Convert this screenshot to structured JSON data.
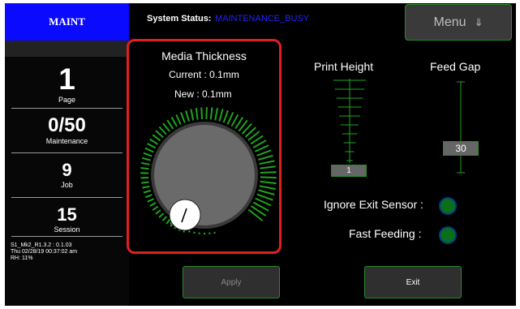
{
  "header": {
    "badge": "MAINT",
    "status_label": "System Status:",
    "status_value": "MAINTENANCE_BUSY",
    "menu_label": "Menu",
    "menu_arrow": "⇓"
  },
  "sidebar": {
    "stats": [
      {
        "value": "1",
        "label": "Page"
      },
      {
        "value": "0/50",
        "label": "Maintenance"
      },
      {
        "value": "9",
        "label": "Job"
      },
      {
        "value": "15",
        "label": "Session"
      }
    ],
    "info": {
      "version": "S1_Mk2_R1.3.2 : 0.1.03",
      "datetime": "Thu 02/28/19 00:37:02 am",
      "humidity": "RH: 11%"
    }
  },
  "media_thickness": {
    "title": "Media Thickness",
    "current": "Current : 0.1mm",
    "new": "New : 0.1mm"
  },
  "print_height": {
    "label": "Print Height",
    "value": "1"
  },
  "feed_gap": {
    "label": "Feed Gap",
    "value": "30"
  },
  "toggles": [
    {
      "label": "Ignore Exit Sensor :",
      "on": true
    },
    {
      "label": "Fast Feeding :",
      "on": true
    }
  ],
  "buttons": {
    "apply": "Apply",
    "exit": "Exit"
  },
  "colors": {
    "accent": "#0a0aff",
    "status": "#2222ff",
    "highlight": "#e02020",
    "green": "#1fa31f"
  },
  "icons": {
    "menu_arrow": "down-double-arrow-icon",
    "toggle": "led-indicator-icon"
  }
}
